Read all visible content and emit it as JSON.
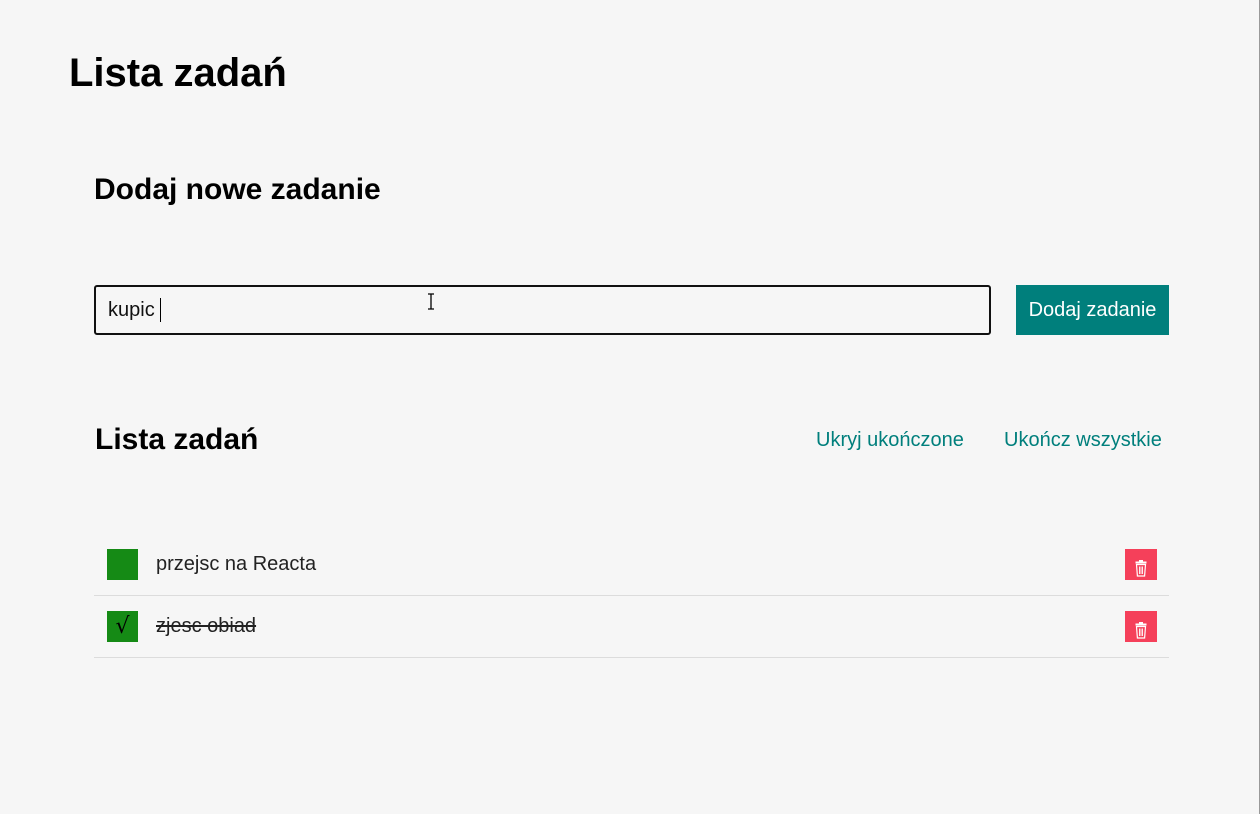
{
  "page": {
    "title": "Lista zadań"
  },
  "add_section": {
    "title": "Dodaj nowe zadanie",
    "input_value": "kupic ",
    "button_label": "Dodaj zadanie"
  },
  "list_section": {
    "title": "Lista zadań",
    "hide_completed_label": "Ukryj ukończone",
    "complete_all_label": "Ukończ wszystkie",
    "tasks": [
      {
        "text": "przejsc na Reacta",
        "done": false,
        "check_glyph": ""
      },
      {
        "text": "zjesc obiad",
        "done": true,
        "check_glyph": "√"
      }
    ]
  },
  "colors": {
    "background": "#f6f6f6",
    "accent": "#007f7c",
    "checkbox": "#158a15",
    "delete": "#f5405a",
    "divider": "#dcdcdc"
  },
  "icons": {
    "delete": "trash-icon",
    "checkmark": "checkmark-icon",
    "cursor": "text-cursor-icon"
  }
}
